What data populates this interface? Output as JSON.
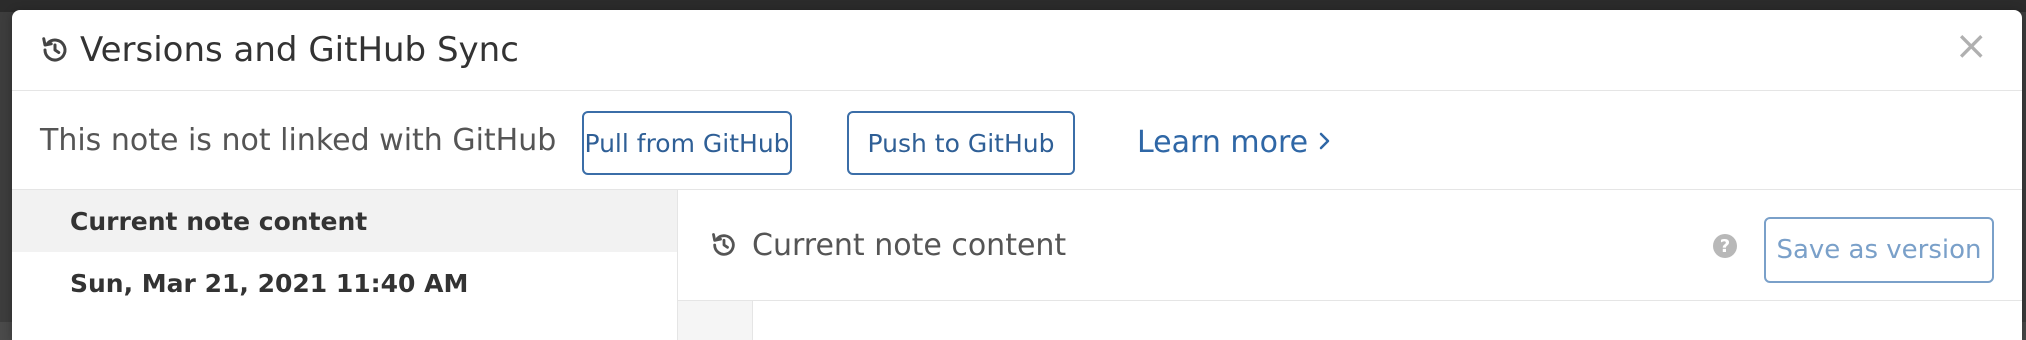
{
  "modal": {
    "title": "Versions and GitHub Sync",
    "close_label": "×"
  },
  "sync": {
    "status_text": "This note is not linked with GitHub",
    "pull_label": "Pull from GitHub",
    "push_label": "Push to GitHub",
    "learn_more_label": "Learn more",
    "accent_color": "#2f67a6"
  },
  "sidebar": {
    "items": [
      {
        "label": "Current note content"
      },
      {
        "label": "Sun, Mar 21, 2021 11:40 AM"
      }
    ]
  },
  "content": {
    "title": "Current note content",
    "help_label": "?",
    "save_label": "Save as version"
  },
  "icons": {
    "history": "history-icon",
    "close": "close-icon",
    "chevron": "chevron-right-icon",
    "help": "help-icon"
  }
}
